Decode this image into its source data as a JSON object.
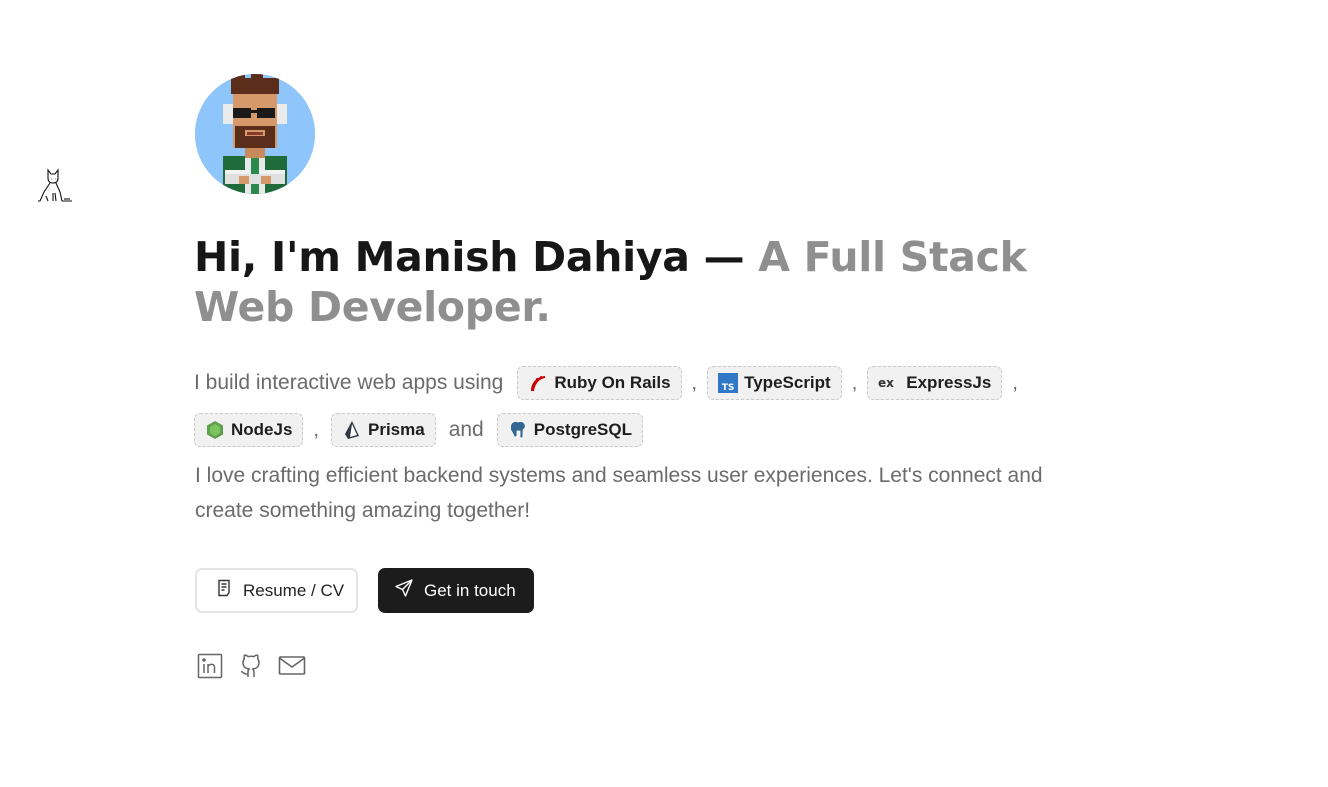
{
  "header": {
    "avatar_alt": "Manish Dahiya pixel avatar"
  },
  "hero": {
    "headline_dark": "Hi, I'm Manish Dahiya — ",
    "headline_muted": "A Full Stack Web Developer."
  },
  "intro": {
    "prefix": "I build interactive web apps using",
    "sep": ",",
    "and": "and",
    "tech": [
      {
        "label": "Ruby On Rails",
        "icon": "rails-icon",
        "color": "#cc0000"
      },
      {
        "label": "TypeScript",
        "icon": "typescript-icon",
        "color": "#3178c6"
      },
      {
        "label": "ExpressJs",
        "icon": "express-icon",
        "color": "#333333"
      },
      {
        "label": "NodeJs",
        "icon": "nodejs-icon",
        "color": "#5fa04e"
      },
      {
        "label": "Prisma",
        "icon": "prisma-icon",
        "color": "#2d3748"
      },
      {
        "label": "PostgreSQL",
        "icon": "postgresql-icon",
        "color": "#336791"
      }
    ],
    "paragraph": " I love crafting efficient backend systems and seamless user experiences. Let's connect and create something amazing together!"
  },
  "actions": {
    "resume_label": "Resume / CV",
    "contact_label": "Get in touch"
  },
  "socials": [
    {
      "name": "linkedin",
      "icon": "linkedin-icon"
    },
    {
      "name": "github",
      "icon": "github-icon"
    },
    {
      "name": "email",
      "icon": "mail-icon"
    }
  ],
  "colors": {
    "avatar_bg": "#8ec5fa",
    "headline_dark": "#171717",
    "headline_muted": "#8f8f8f",
    "body_text": "#6b6b6b",
    "chip_bg": "#f1f1f1",
    "primary_button": "#1c1c1c"
  }
}
